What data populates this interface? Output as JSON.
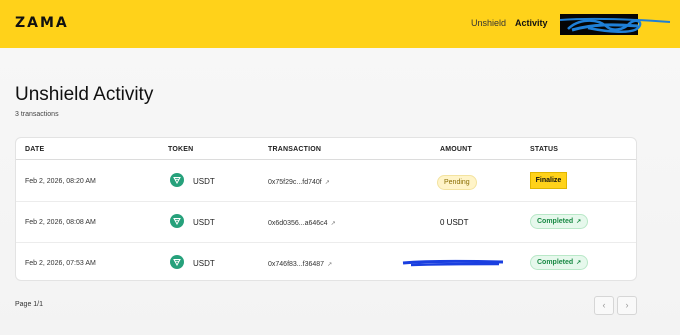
{
  "header": {
    "logo": "ZAMA",
    "nav": {
      "unshield": "Unshield",
      "activity": "Activity"
    },
    "brand_color": "#ffd21a"
  },
  "page": {
    "title": "Unshield Activity",
    "count": "3 transactions"
  },
  "table": {
    "columns": [
      "DATE",
      "TOKEN",
      "TRANSACTION",
      "AMOUNT",
      "STATUS"
    ],
    "rows": [
      {
        "date": "Feb 2, 2026, 08:20 AM",
        "token": "USDT",
        "tx": "0x75f29c...fd740f",
        "amount": "Pending",
        "status": "Finalize"
      },
      {
        "date": "Feb 2, 2026, 08:08 AM",
        "token": "USDT",
        "tx": "0x6d0356...a646c4",
        "amount": "0 USDT",
        "status": "Completed"
      },
      {
        "date": "Feb 2, 2026, 07:53 AM",
        "token": "USDT",
        "tx": "0x746f83...f36487",
        "amount": "",
        "status": "Completed"
      }
    ]
  },
  "pagination": {
    "label": "Page 1/1",
    "prev": "‹",
    "next": "›"
  },
  "icons": {
    "token": "tether-icon",
    "external": "external-link-icon"
  }
}
